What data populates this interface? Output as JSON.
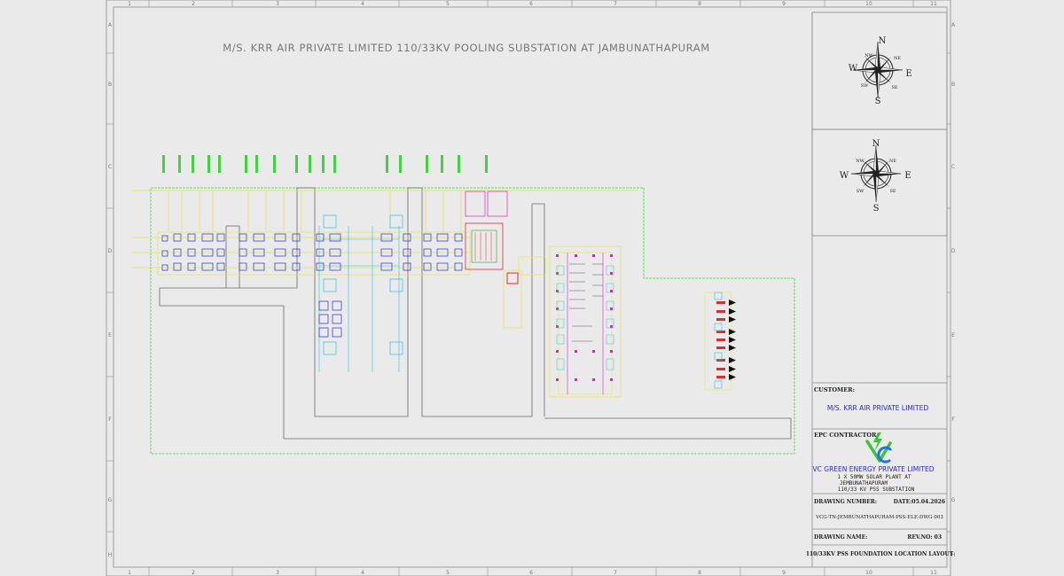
{
  "drawing": {
    "title": "M/S. KRR AIR PRIVATE LIMITED 110/33KV POOLING SUBSTATION AT JAMBUNATHAPURAM",
    "column_numbers": [
      "1",
      "2",
      "3",
      "4",
      "5",
      "6",
      "7",
      "8",
      "9",
      "10",
      "11"
    ],
    "row_letters": [
      "A",
      "B",
      "C",
      "D",
      "E",
      "F",
      "G",
      "H"
    ]
  },
  "compass": {
    "north": "N",
    "south": "S",
    "east": "E",
    "west": "W",
    "northeast": "NE",
    "northwest": "NW",
    "southeast": "SE",
    "southwest": "SW"
  },
  "title_block": {
    "customer_label": "CUSTOMER:",
    "customer_name": "M/S. KRR AIR PRIVATE LIMITED",
    "epc_label": "EPC CONTRACTOR:",
    "epc_name": "VC GREEN ENERGY PRIVATE LIMITED",
    "project_line1": "1 X 50MW SOLAR PLANT AT",
    "project_line2": "JEMBUNATHAPURAM",
    "project_line3": "110/33 KV PSS SUBSTATION",
    "drawing_number_label": "DRAWING NUMBER:",
    "date": "DATE:05.04.2026",
    "drawing_number": "VCG-TN-JEMBUNATHAPURAM-PSS-ELE-DWG-003",
    "drawing_name_label": "DRAWING NAME:",
    "revision": "REV.NO: 03",
    "drawing_name": "110/33KV PSS FOUNDATION LOCATION LAYOUT"
  },
  "colors": {
    "background": "#eaeaea",
    "frame": "#8a8a8a",
    "fence_green": "#3fd43f",
    "gantry_yellow": "#e6e64a",
    "equipment_blue": "#2a2ae0",
    "panel_magenta": "#e020c0",
    "grid_cyan": "#2ac0e0",
    "road_grey": "#6a6a6a",
    "customer_text_blue": "#2a2ad8",
    "logo_green": "#39c43a",
    "logo_blue": "#2a6fe0"
  }
}
